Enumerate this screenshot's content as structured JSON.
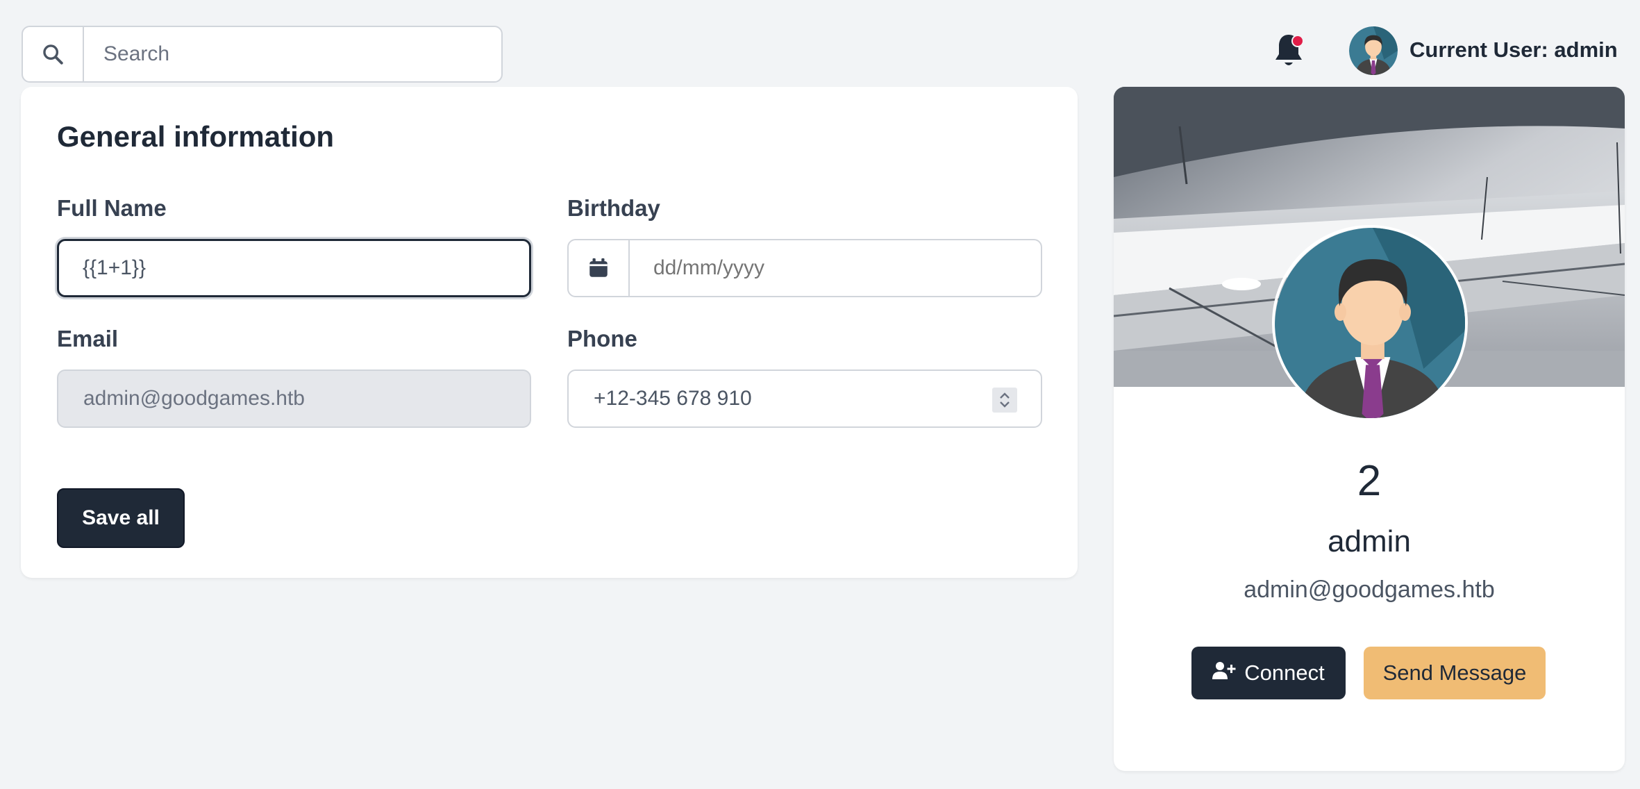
{
  "search": {
    "placeholder": "Search",
    "icon": "search-icon"
  },
  "header": {
    "notification_icon": "bell-icon",
    "notification_dot_color": "#e11d48",
    "current_user_label": "Current User: admin"
  },
  "general_info": {
    "title": "General information",
    "full_name": {
      "label": "Full Name",
      "value": "{{1+1}}"
    },
    "birthday": {
      "label": "Birthday",
      "placeholder": "dd/mm/yyyy",
      "icon": "calendar-icon"
    },
    "email": {
      "label": "Email",
      "value": "admin@goodgames.htb"
    },
    "phone": {
      "label": "Phone",
      "value": "+12-345 678 910"
    },
    "save_label": "Save all"
  },
  "profile": {
    "number": "2",
    "name": "admin",
    "email": "admin@goodgames.htb",
    "connect_label": "Connect",
    "connect_icon": "user-plus-icon",
    "message_label": "Send Message"
  },
  "colors": {
    "primary": "#1f2937",
    "accent": "#f0bc74",
    "background": "#f2f4f6"
  }
}
